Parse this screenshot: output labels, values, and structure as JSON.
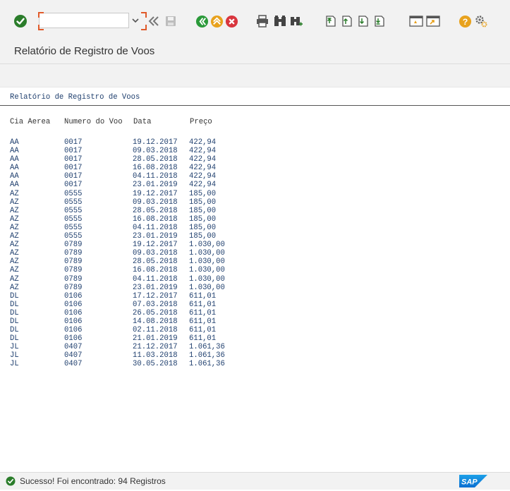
{
  "toolbar": {
    "command_field": {
      "value": "",
      "placeholder": ""
    },
    "icons": [
      "enter-icon",
      "command-dropdown-icon",
      "collapse-icon",
      "save-icon",
      "back-icon",
      "exit-icon",
      "cancel-icon",
      "print-icon",
      "find-icon",
      "find-next-icon",
      "first-page-icon",
      "previous-page-icon",
      "next-page-icon",
      "last-page-icon",
      "create-session-icon",
      "shortcut-icon",
      "help-icon",
      "settings-icon"
    ]
  },
  "window": {
    "title": "Relatório de Registro de Voos"
  },
  "report": {
    "title": "Relatório de Registro de Voos",
    "columns": [
      "Cia Aerea",
      "Numero do Voo",
      "Data",
      "Preço"
    ],
    "rows": [
      [
        "AA",
        "0017",
        "19.12.2017",
        "422,94"
      ],
      [
        "AA",
        "0017",
        "09.03.2018",
        "422,94"
      ],
      [
        "AA",
        "0017",
        "28.05.2018",
        "422,94"
      ],
      [
        "AA",
        "0017",
        "16.08.2018",
        "422,94"
      ],
      [
        "AA",
        "0017",
        "04.11.2018",
        "422,94"
      ],
      [
        "AA",
        "0017",
        "23.01.2019",
        "422,94"
      ],
      [
        "AZ",
        "0555",
        "19.12.2017",
        "185,00"
      ],
      [
        "AZ",
        "0555",
        "09.03.2018",
        "185,00"
      ],
      [
        "AZ",
        "0555",
        "28.05.2018",
        "185,00"
      ],
      [
        "AZ",
        "0555",
        "16.08.2018",
        "185,00"
      ],
      [
        "AZ",
        "0555",
        "04.11.2018",
        "185,00"
      ],
      [
        "AZ",
        "0555",
        "23.01.2019",
        "185,00"
      ],
      [
        "AZ",
        "0789",
        "19.12.2017",
        "1.030,00"
      ],
      [
        "AZ",
        "0789",
        "09.03.2018",
        "1.030,00"
      ],
      [
        "AZ",
        "0789",
        "28.05.2018",
        "1.030,00"
      ],
      [
        "AZ",
        "0789",
        "16.08.2018",
        "1.030,00"
      ],
      [
        "AZ",
        "0789",
        "04.11.2018",
        "1.030,00"
      ],
      [
        "AZ",
        "0789",
        "23.01.2019",
        "1.030,00"
      ],
      [
        "DL",
        "0106",
        "17.12.2017",
        "611,01"
      ],
      [
        "DL",
        "0106",
        "07.03.2018",
        "611,01"
      ],
      [
        "DL",
        "0106",
        "26.05.2018",
        "611,01"
      ],
      [
        "DL",
        "0106",
        "14.08.2018",
        "611,01"
      ],
      [
        "DL",
        "0106",
        "02.11.2018",
        "611,01"
      ],
      [
        "DL",
        "0106",
        "21.01.2019",
        "611,01"
      ],
      [
        "JL",
        "0407",
        "21.12.2017",
        "1.061,36"
      ],
      [
        "JL",
        "0407",
        "11.03.2018",
        "1.061,36"
      ],
      [
        "JL",
        "0407",
        "30.05.2018",
        "1.061,36"
      ]
    ]
  },
  "status": {
    "message": "Sucesso! Foi encontrado: 94  Registros",
    "type": "success"
  },
  "brand": {
    "logo_text": "SAP"
  },
  "colors": {
    "accent_blue": "#0a6ed1",
    "success_green": "#2b7d2b",
    "report_text": "#1f3f6e",
    "toolbar_bg": "#f2f2f2",
    "warning_orange": "#e8a21d",
    "cancel_red": "#d9363e"
  }
}
